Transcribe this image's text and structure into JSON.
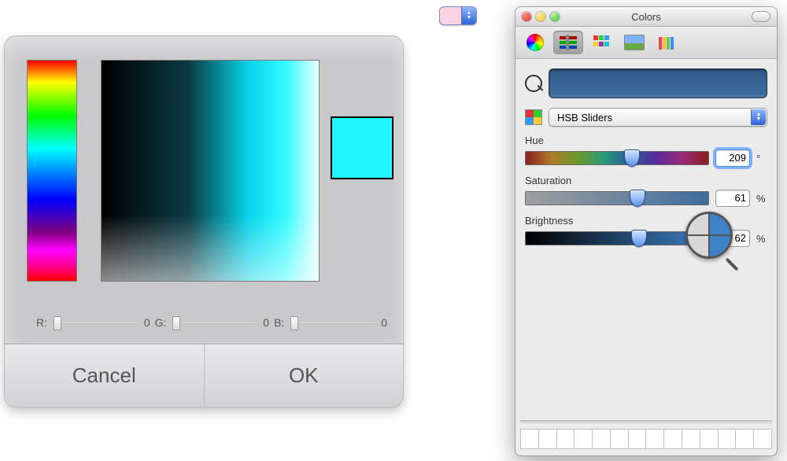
{
  "picker": {
    "rgb": {
      "r_label": "R:",
      "r_val": "0",
      "g_label": "G:",
      "g_val": "0",
      "b_label": "B:",
      "b_val": "0"
    },
    "swatch_color": "#1ff6ff",
    "buttons": {
      "cancel": "Cancel",
      "ok": "OK"
    }
  },
  "popup_control": {
    "color": "#ffd1e4"
  },
  "colors_panel": {
    "title": "Colors",
    "dropdown_label": "HSB Sliders",
    "big_swatch": "#3e6e9e",
    "sliders": {
      "hue": {
        "label": "Hue",
        "value": "209",
        "unit": "°",
        "pct": 58
      },
      "saturation": {
        "label": "Saturation",
        "value": "61",
        "unit": "%",
        "pct": 61
      },
      "brightness": {
        "label": "Brightness",
        "value": "62",
        "unit": "%",
        "pct": 62
      }
    },
    "tray_cells": 14
  }
}
